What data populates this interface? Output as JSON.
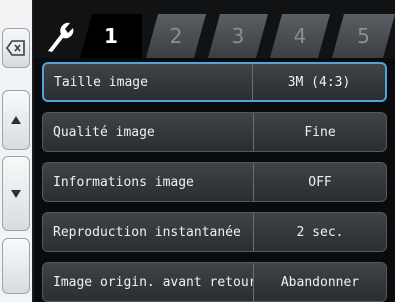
{
  "tabs": [
    "1",
    "2",
    "3",
    "4",
    "5"
  ],
  "rows": [
    {
      "label": "Taille image",
      "value": "3M (4:3)"
    },
    {
      "label": "Qualité image",
      "value": "Fine"
    },
    {
      "label": "Informations image",
      "value": "OFF"
    },
    {
      "label": "Reproduction instantanée",
      "value": "2 sec."
    },
    {
      "label": "Image origin. avant retour",
      "value": "Abandonner"
    }
  ],
  "colors": {
    "selected_border": "#4ea6d8",
    "background": "#1a1c1e"
  },
  "icons": {
    "back": "backspace-icon",
    "up": "arrow-up-icon",
    "down": "arrow-down-icon",
    "settings_tab": "wrench-icon"
  }
}
